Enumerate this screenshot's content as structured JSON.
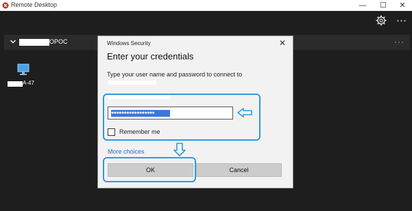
{
  "window": {
    "title": "Remote Desktop",
    "minimize": "—",
    "maximize": "☐",
    "close": "✕"
  },
  "header": {
    "settings_icon": "gear-icon",
    "more_icon": "ellipsis-icon",
    "more_glyph": "⋯"
  },
  "group": {
    "name_suffix": "OPOC",
    "more_glyph": "···"
  },
  "pc": {
    "name_suffix": "A-47"
  },
  "dialog": {
    "caption": "Windows Security",
    "close_glyph": "✕",
    "heading": "Enter your credentials",
    "prompt": "Type your user name and password to connect to",
    "password_value": "●●●●●●●●●●●●●●●●●",
    "remember_label": "Remember me",
    "more_choices": "More choices",
    "ok_label": "OK",
    "cancel_label": "Cancel"
  },
  "colors": {
    "highlight": "#2b9be0",
    "link": "#1f6fd1",
    "selection": "#3a78d6"
  }
}
